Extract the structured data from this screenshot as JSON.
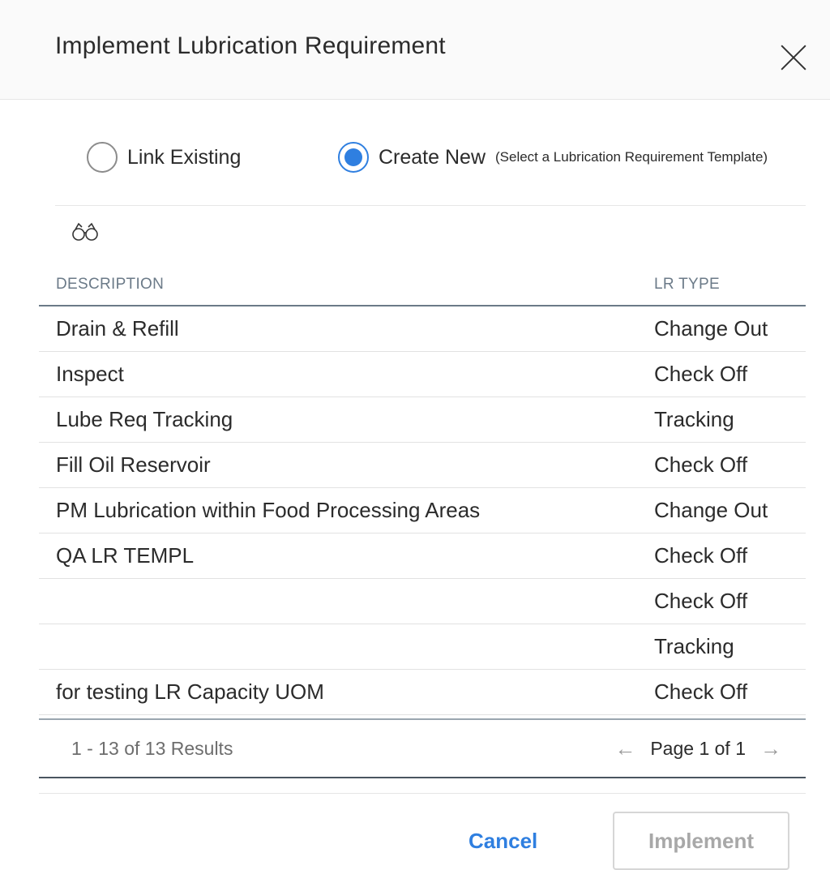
{
  "dialog": {
    "title": "Implement Lubrication Requirement"
  },
  "options": {
    "link_existing": "Link Existing",
    "create_new": "Create New",
    "create_new_hint": "(Select a Lubrication Requirement Template)",
    "selected": "create_new"
  },
  "table": {
    "columns": [
      "DESCRIPTION",
      "LR TYPE"
    ],
    "rows": [
      {
        "description": "Drain & Refill",
        "lr_type": "Change Out"
      },
      {
        "description": "Inspect",
        "lr_type": "Check Off"
      },
      {
        "description": "Lube Req Tracking",
        "lr_type": "Tracking"
      },
      {
        "description": "Fill Oil Reservoir",
        "lr_type": "Check Off"
      },
      {
        "description": "PM Lubrication within Food Processing Areas",
        "lr_type": "Change Out"
      },
      {
        "description": "QA LR TEMPL",
        "lr_type": "Check Off"
      },
      {
        "description": "",
        "lr_type": "Check Off"
      },
      {
        "description": "",
        "lr_type": "Tracking"
      },
      {
        "description": "for testing LR Capacity UOM",
        "lr_type": "Check Off"
      }
    ]
  },
  "pager": {
    "results": "1 - 13 of 13 Results",
    "page": "Page 1 of 1",
    "prev_icon": "←",
    "next_icon": "→"
  },
  "footer": {
    "cancel_label": "Cancel",
    "implement_label": "Implement"
  },
  "colors": {
    "accent": "#2f7fe0",
    "header_bg": "#fafafa"
  }
}
